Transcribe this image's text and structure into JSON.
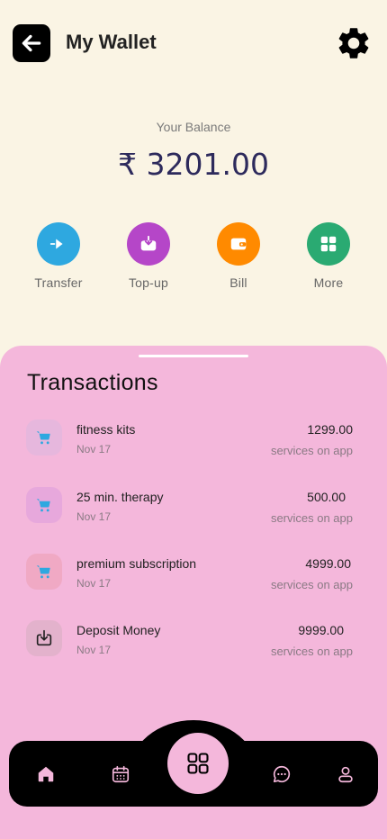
{
  "header": {
    "title": "My Wallet"
  },
  "balance": {
    "label": "Your Balance",
    "amount": "₹ 3201.00"
  },
  "actions": [
    {
      "label": "Transfer",
      "icon": "transfer-icon",
      "color": "#2ea8e0"
    },
    {
      "label": "Top-up",
      "icon": "topup-icon",
      "color": "#b546c8"
    },
    {
      "label": "Bill",
      "icon": "bill-icon",
      "color": "#ff8a00"
    },
    {
      "label": "More",
      "icon": "grid-icon",
      "color": "#2aaa72"
    }
  ],
  "transactions": {
    "title": "Transactions",
    "items": [
      {
        "name": "fitness kits",
        "date": "Nov 17",
        "amount": "1299.00",
        "sub": "services on app",
        "icon": "cart-icon",
        "icon_bg": "#e6b7dd"
      },
      {
        "name": "25 min. therapy",
        "date": "Nov 17",
        "amount": "500.00",
        "sub": "services on app",
        "icon": "cart-icon",
        "icon_bg": "#e7a8dc"
      },
      {
        "name": "premium subscription",
        "date": "Nov 17",
        "amount": "4999.00",
        "sub": "services on app",
        "icon": "cart-icon",
        "icon_bg": "#f0a9c4"
      },
      {
        "name": "Deposit Money",
        "date": "Nov 17",
        "amount": "9999.00",
        "sub": "services on app",
        "icon": "deposit-icon",
        "icon_bg": "#e3b2cc"
      }
    ]
  },
  "nav": {
    "items": [
      "home-icon",
      "calendar-icon",
      "grid-icon",
      "chat-icon",
      "profile-icon"
    ],
    "accent": "#f4b7db"
  }
}
